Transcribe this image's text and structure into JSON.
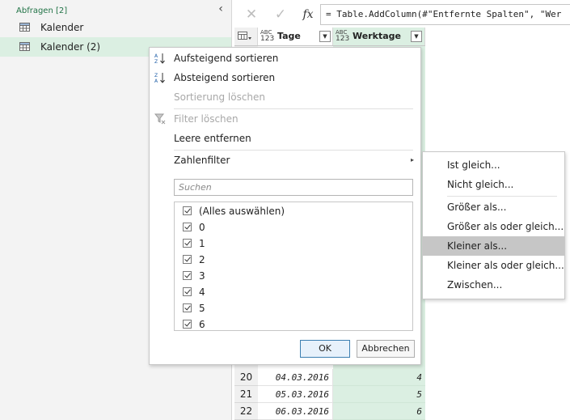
{
  "query_pane": {
    "title": "Abfragen [2]",
    "collapse_glyph": "‹",
    "items": [
      {
        "label": "Kalender"
      },
      {
        "label": "Kalender (2)"
      }
    ]
  },
  "formula_bar": {
    "cancel_glyph": "✕",
    "confirm_glyph": "✓",
    "fx_label": "fx",
    "formula": "= Table.AddColumn(#\"Entfernte Spalten\", \"Wer"
  },
  "grid": {
    "columns": [
      {
        "type_top": "ABC",
        "type_bottom": "123",
        "title": "Tage"
      },
      {
        "type_top": "ABC",
        "type_bottom": "123",
        "title": "Werktage"
      }
    ],
    "rows": [
      {
        "num": "20",
        "date": "04.03.2016",
        "value": "4"
      },
      {
        "num": "21",
        "date": "05.03.2016",
        "value": "5"
      },
      {
        "num": "22",
        "date": "06.03.2016",
        "value": "6"
      }
    ]
  },
  "filter_menu": {
    "sort_asc": "Aufsteigend sortieren",
    "sort_desc": "Absteigend sortieren",
    "clear_sort": "Sortierung löschen",
    "clear_filter": "Filter löschen",
    "remove_empty": "Leere entfernen",
    "number_filters": "Zahlenfilter",
    "search_placeholder": "Suchen",
    "values": [
      {
        "label": "(Alles auswählen)",
        "checked": true
      },
      {
        "label": "0",
        "checked": true
      },
      {
        "label": "1",
        "checked": true
      },
      {
        "label": "2",
        "checked": true
      },
      {
        "label": "3",
        "checked": true
      },
      {
        "label": "4",
        "checked": true
      },
      {
        "label": "5",
        "checked": true
      },
      {
        "label": "6",
        "checked": true
      }
    ],
    "ok_label": "OK",
    "cancel_label": "Abbrechen"
  },
  "number_submenu": {
    "items": [
      {
        "label": "Ist gleich..."
      },
      {
        "label": "Nicht gleich..."
      },
      {
        "label": "Größer als..."
      },
      {
        "label": "Größer als oder gleich..."
      },
      {
        "label": "Kleiner als..."
      },
      {
        "label": "Kleiner als oder gleich..."
      },
      {
        "label": "Zwischen..."
      }
    ],
    "highlighted": "Kleiner als..."
  },
  "colors": {
    "accent_green": "#217346",
    "selected_bg": "#dbefe2",
    "hover_bg": "#c6c6c6"
  }
}
